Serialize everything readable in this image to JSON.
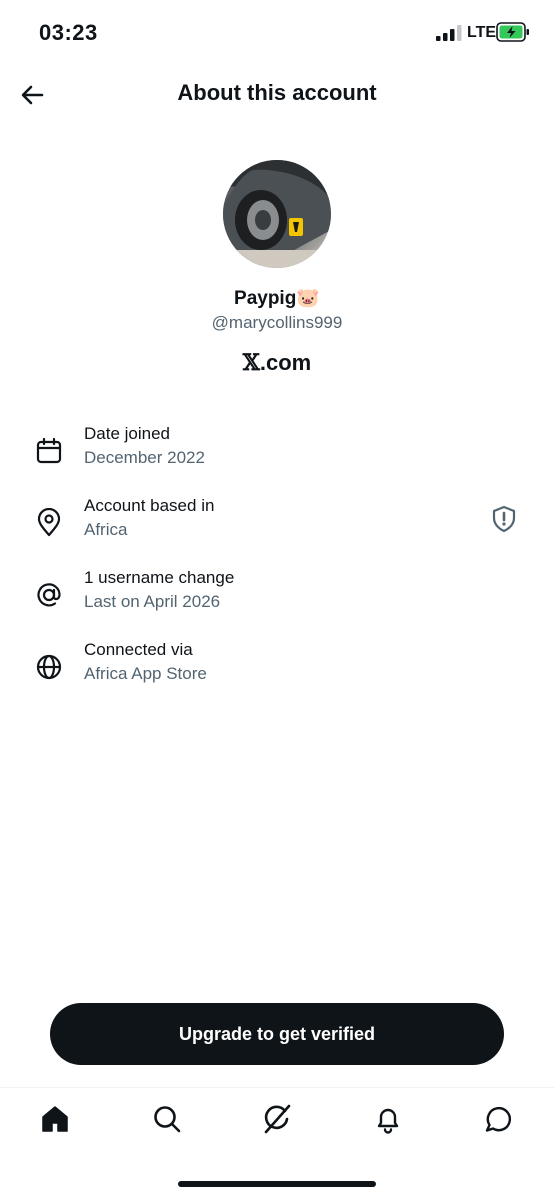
{
  "status_bar": {
    "time": "03:23",
    "network": "LTE",
    "battery_charging": true
  },
  "header": {
    "title": "About this account"
  },
  "profile": {
    "display_name": "Paypig🐷",
    "handle": "@marycollins999",
    "brand_x": "𝕏",
    "brand_suffix": ".com"
  },
  "info_rows": [
    {
      "icon": "calendar-icon",
      "label": "Date joined",
      "value": "December 2022"
    },
    {
      "icon": "location-pin-icon",
      "label": "Account based in",
      "value": "Africa"
    },
    {
      "icon": "at-sign-icon",
      "label": "1 username change",
      "value": "Last on April 2026"
    },
    {
      "icon": "globe-icon",
      "label": "Connected via",
      "value": "Africa App Store"
    }
  ],
  "cta": {
    "label": "Upgrade to get verified"
  },
  "bottom_nav": [
    "home-icon",
    "search-icon",
    "grok-icon",
    "notifications-icon",
    "messages-icon"
  ],
  "colors": {
    "text": "#0f1419",
    "secondary": "#536471",
    "battery_green": "#34c759"
  }
}
